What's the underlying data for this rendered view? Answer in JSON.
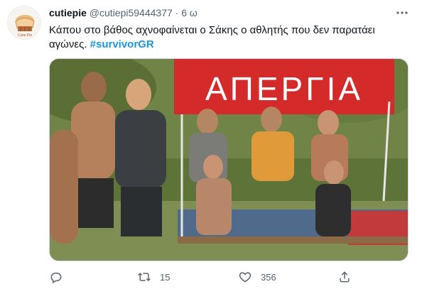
{
  "tweet": {
    "display_name": "cutiepie",
    "handle": "@cutiepi59444377",
    "separator": "·",
    "time": "6 ω",
    "text_main": "Κάπου στο βάθος αχνοφαίνεται ο Σάκης ο αθλητής που δεν παρατάει αγώνες.",
    "hashtag": "#survivorGR",
    "avatar_caption": "Cutie Pie",
    "media": {
      "banner_text": "ΑΠΕΡΓΙΑ"
    },
    "actions": {
      "retweet_count": "15",
      "like_count": "356"
    }
  },
  "colors": {
    "accent": "#1b95e0",
    "secondary_text": "#536471",
    "banner_red": "#d42a2a"
  },
  "icons": [
    "more-icon",
    "reply-icon",
    "retweet-icon",
    "like-icon",
    "share-icon"
  ]
}
